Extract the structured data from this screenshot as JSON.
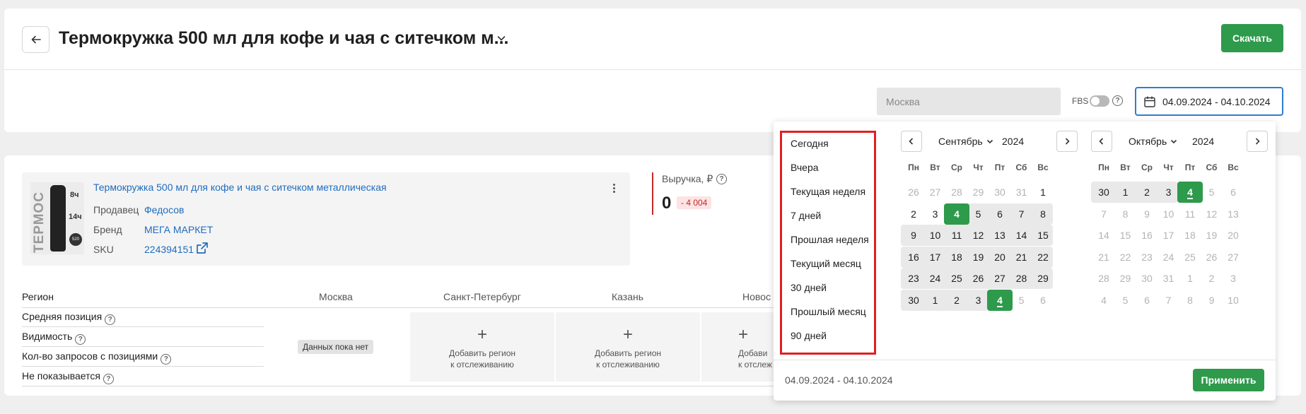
{
  "header": {
    "title": "Термокружка 500 мл для кофе и чая с ситечком м...",
    "download_label": "Скачать"
  },
  "filters": {
    "city_placeholder": "Москва",
    "fbs_label": "FBS",
    "fbs_enabled": false,
    "date_range": "04.09.2024 - 04.10.2024"
  },
  "product": {
    "name": "Термокружка 500 мл для кофе и чая с ситечком металлическая",
    "image_text": {
      "brand": "ТЕРМОС",
      "hours_hot": "8ч",
      "hours_cold": "14ч",
      "badge": "520"
    },
    "meta": [
      {
        "label": "Продавец",
        "value": "Федосов"
      },
      {
        "label": "Бренд",
        "value": "МЕГА МАРКЕТ"
      },
      {
        "label": "SKU",
        "value": "224394151"
      }
    ]
  },
  "revenue": {
    "label": "Выручка, ₽",
    "value": "0",
    "delta": "- 4 004"
  },
  "regions": {
    "header_label": "Регион",
    "columns": [
      "Москва",
      "Санкт-Петербург",
      "Казань",
      "Новос"
    ],
    "rows": [
      "Средняя позиция",
      "Видимость",
      "Кол-во запросов с позициями",
      "Не показывается"
    ],
    "no_data": "Данных пока нет",
    "add_region_line1": "Добавить регион",
    "add_region_line2": "к отслеживанию",
    "add_region_partial_line1": "Добави",
    "add_region_partial_line2": "к отслеж"
  },
  "calendar": {
    "presets": [
      "Сегодня",
      "Вчера",
      "Текущая неделя",
      "7 дней",
      "Прошлая неделя",
      "Текущий месяц",
      "30 дней",
      "Прошлый месяц",
      "90 дней"
    ],
    "weekdays": [
      "Пн",
      "Вт",
      "Ср",
      "Чт",
      "Пт",
      "Сб",
      "Вс"
    ],
    "left": {
      "month": "Сентябрь",
      "year": "2024",
      "weeks": [
        [
          "26",
          "27",
          "28",
          "29",
          "30",
          "31",
          "1"
        ],
        [
          "2",
          "3",
          "4",
          "5",
          "6",
          "7",
          "8"
        ],
        [
          "9",
          "10",
          "11",
          "12",
          "13",
          "14",
          "15"
        ],
        [
          "16",
          "17",
          "18",
          "19",
          "20",
          "21",
          "22"
        ],
        [
          "23",
          "24",
          "25",
          "26",
          "27",
          "28",
          "29"
        ],
        [
          "30",
          "1",
          "2",
          "3",
          "4",
          "5",
          "6"
        ]
      ]
    },
    "right": {
      "month": "Октябрь",
      "year": "2024",
      "weeks": [
        [
          "30",
          "1",
          "2",
          "3",
          "4",
          "5",
          "6"
        ],
        [
          "7",
          "8",
          "9",
          "10",
          "11",
          "12",
          "13"
        ],
        [
          "14",
          "15",
          "16",
          "17",
          "18",
          "19",
          "20"
        ],
        [
          "21",
          "22",
          "23",
          "24",
          "25",
          "26",
          "27"
        ],
        [
          "28",
          "29",
          "30",
          "31",
          "1",
          "2",
          "3"
        ],
        [
          "4",
          "5",
          "6",
          "7",
          "8",
          "9",
          "10"
        ]
      ]
    },
    "footer_range": "04.09.2024 - 04.10.2024",
    "apply_label": "Применить"
  },
  "colors": {
    "accent_green": "#2e9a4b",
    "link_blue": "#1f6cbd",
    "focus_blue": "#2e7dd1",
    "negative_red": "#c62828",
    "highlight_red": "#e02020"
  }
}
